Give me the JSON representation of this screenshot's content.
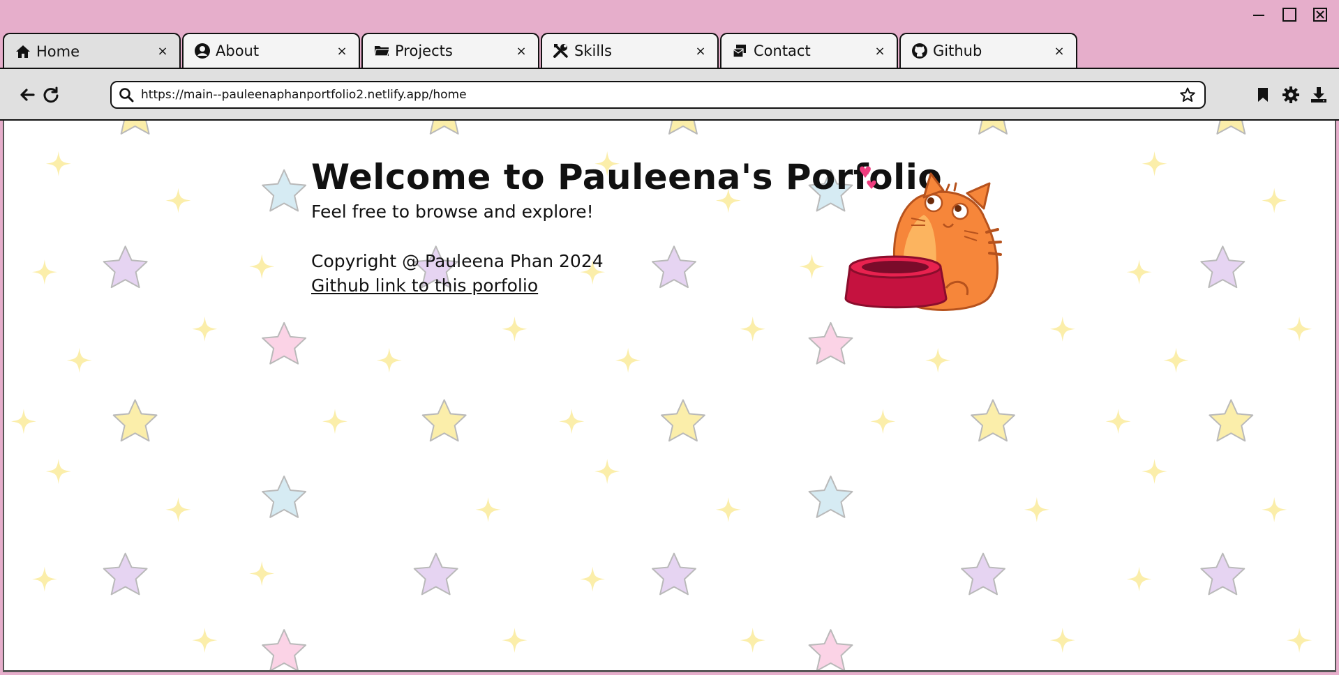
{
  "window": {
    "controls": [
      "minimize",
      "maximize",
      "close"
    ]
  },
  "tabs": [
    {
      "label": "Home",
      "icon": "home-icon",
      "active": true,
      "close": "×"
    },
    {
      "label": "About",
      "icon": "user-circle-icon",
      "active": false,
      "close": "×"
    },
    {
      "label": "Projects",
      "icon": "folder-icon",
      "active": false,
      "close": "×"
    },
    {
      "label": "Skills",
      "icon": "tools-icon",
      "active": false,
      "close": "×"
    },
    {
      "label": "Contact",
      "icon": "contact-icon",
      "active": false,
      "close": "×"
    },
    {
      "label": "Github",
      "icon": "github-icon",
      "active": false,
      "close": "×"
    }
  ],
  "toolbar": {
    "url": "https://main--pauleenaphanportfolio2.netlify.app/home"
  },
  "page": {
    "title": "Welcome to Pauleena's Porfolio",
    "subtitle": "Feel free to browse and explore!",
    "copyright": "Copyright @ Pauleena Phan 2024",
    "github_link": "Github link to this porfolio"
  },
  "colors": {
    "titlebar": "#e6aecb",
    "toolbar": "#e0e0e0",
    "star_yellow": "#fbeeaa",
    "star_blue": "#d6ebf3",
    "star_purple": "#e6d4f2",
    "star_pink": "#fbd3e6"
  }
}
